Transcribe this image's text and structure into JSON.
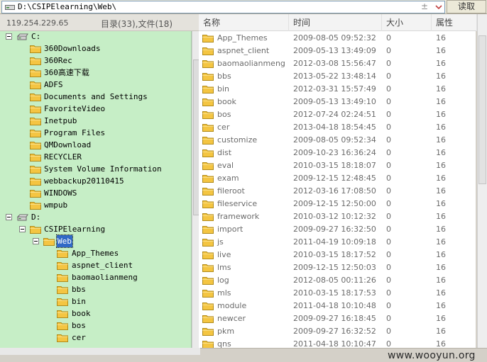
{
  "path_bar": {
    "path": "D:\\CSIPElearning\\Web\\",
    "read_button": "读取"
  },
  "info_bar": {
    "ip": "119.254.229.65",
    "counts": "目录(33),文件(18)"
  },
  "tree": {
    "drive_c": "C:",
    "c_children": [
      "360Downloads",
      "360Rec",
      "360高速下载",
      "ADFS",
      "Documents and Settings",
      "FavoriteVideo",
      "Inetpub",
      "Program Files",
      "QMDownload",
      "RECYCLER",
      "System Volume Information",
      "webbackup20110415",
      "WINDOWS",
      "wmpub"
    ],
    "drive_d": "D:",
    "d_child": "CSIPElearning",
    "web_folder": "Web",
    "web_children": [
      "App_Themes",
      "aspnet_client",
      "baomaolianmeng",
      "bbs",
      "bin",
      "book",
      "bos",
      "cer"
    ]
  },
  "list": {
    "headers": [
      "名称",
      "时间",
      "大小",
      "属性"
    ],
    "rows": [
      {
        "name": "App_Themes",
        "time": "2009-08-05 09:52:32",
        "size": "0",
        "attr": "16"
      },
      {
        "name": "aspnet_client",
        "time": "2009-05-13 13:49:09",
        "size": "0",
        "attr": "16"
      },
      {
        "name": "baomaolianmeng",
        "time": "2012-03-08 15:56:47",
        "size": "0",
        "attr": "16"
      },
      {
        "name": "bbs",
        "time": "2013-05-22 13:48:14",
        "size": "0",
        "attr": "16"
      },
      {
        "name": "bin",
        "time": "2012-03-31 15:57:49",
        "size": "0",
        "attr": "16"
      },
      {
        "name": "book",
        "time": "2009-05-13 13:49:10",
        "size": "0",
        "attr": "16"
      },
      {
        "name": "bos",
        "time": "2012-07-24 02:24:51",
        "size": "0",
        "attr": "16"
      },
      {
        "name": "cer",
        "time": "2013-04-18 18:54:45",
        "size": "0",
        "attr": "16"
      },
      {
        "name": "customize",
        "time": "2009-08-05 09:52:34",
        "size": "0",
        "attr": "16"
      },
      {
        "name": "dist",
        "time": "2009-10-23 16:36:24",
        "size": "0",
        "attr": "16"
      },
      {
        "name": "eval",
        "time": "2010-03-15 18:18:07",
        "size": "0",
        "attr": "16"
      },
      {
        "name": "exam",
        "time": "2009-12-15 12:48:45",
        "size": "0",
        "attr": "16"
      },
      {
        "name": "fileroot",
        "time": "2012-03-16 17:08:50",
        "size": "0",
        "attr": "16"
      },
      {
        "name": "fileservice",
        "time": "2009-12-15 12:50:00",
        "size": "0",
        "attr": "16"
      },
      {
        "name": "framework",
        "time": "2010-03-12 10:12:32",
        "size": "0",
        "attr": "16"
      },
      {
        "name": "import",
        "time": "2009-09-27 16:32:50",
        "size": "0",
        "attr": "16"
      },
      {
        "name": "js",
        "time": "2011-04-19 10:09:18",
        "size": "0",
        "attr": "16"
      },
      {
        "name": "live",
        "time": "2010-03-15 18:17:52",
        "size": "0",
        "attr": "16"
      },
      {
        "name": "lms",
        "time": "2009-12-15 12:50:03",
        "size": "0",
        "attr": "16"
      },
      {
        "name": "log",
        "time": "2012-08-05 00:11:26",
        "size": "0",
        "attr": "16"
      },
      {
        "name": "mls",
        "time": "2010-03-15 18:17:53",
        "size": "0",
        "attr": "16"
      },
      {
        "name": "module",
        "time": "2011-04-18 10:10:48",
        "size": "0",
        "attr": "16"
      },
      {
        "name": "newcer",
        "time": "2009-09-27 16:18:45",
        "size": "0",
        "attr": "16"
      },
      {
        "name": "pkm",
        "time": "2009-09-27 16:32:52",
        "size": "0",
        "attr": "16"
      },
      {
        "name": "qns",
        "time": "2011-04-18 10:10:47",
        "size": "0",
        "attr": "16"
      }
    ]
  },
  "watermark": "www.wooyun.org",
  "colors": {
    "tree_bg": "#c6eec6",
    "folder": "#f4c542",
    "selection": "#3169c6"
  }
}
